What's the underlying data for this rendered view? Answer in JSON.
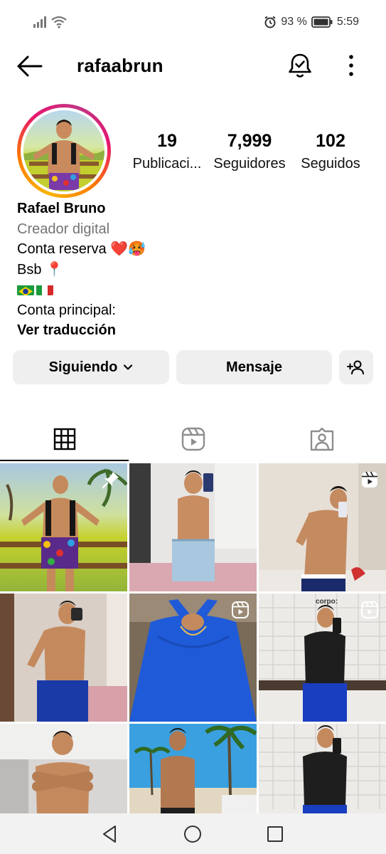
{
  "status_bar": {
    "battery_percent": "93 %",
    "time": "5:59"
  },
  "header": {
    "username": "rafaabrun"
  },
  "stats": [
    {
      "value": "19",
      "label": "Publicaci..."
    },
    {
      "value": "7,999",
      "label": "Seguidores"
    },
    {
      "value": "102",
      "label": "Seguidos"
    }
  ],
  "bio": {
    "name": "Rafael Bruno",
    "category": "Creador digital",
    "line1": "Conta reserva ❤️🥵",
    "line2": "Bsb 📍",
    "line3": "Conta principal:",
    "translate": "Ver traducción"
  },
  "buttons": {
    "following": "Siguiendo",
    "message": "Mensaje"
  },
  "tabs": [
    "grid",
    "reels",
    "tagged"
  ],
  "grid_posts": [
    {
      "type": "pinned",
      "icon": "pin-icon"
    },
    {
      "type": "photo"
    },
    {
      "type": "reel",
      "icon": "reels-icon"
    },
    {
      "type": "photo"
    },
    {
      "type": "reel",
      "icon": "reels-icon"
    },
    {
      "type": "reel",
      "icon": "reels-icon",
      "caption": "corpo:"
    },
    {
      "type": "photo"
    },
    {
      "type": "photo"
    },
    {
      "type": "photo"
    }
  ],
  "colors": {
    "button_bg": "#efefef",
    "secondary_text": "#737373",
    "story_ring_start": "#f7b500",
    "story_ring_end": "#c13584"
  }
}
